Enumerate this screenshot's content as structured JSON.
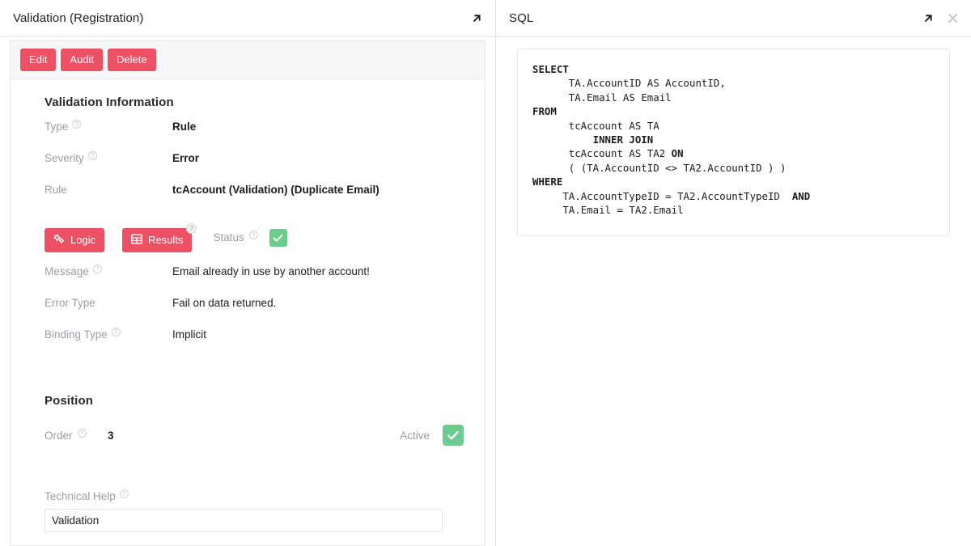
{
  "left_panel": {
    "title": "Validation (Registration)",
    "expand_icon": "expand-arrow-icon",
    "toolbar": {
      "edit_label": "Edit",
      "audit_label": "Audit",
      "delete_label": "Delete"
    },
    "sections": {
      "validation_information": {
        "heading": "Validation Information",
        "fields": [
          {
            "label": "Type",
            "value": "Rule",
            "has_help": true
          },
          {
            "label": "Severity",
            "value": "Error",
            "has_help": true
          },
          {
            "label": "Rule",
            "value": "tcAccount (Validation) (Duplicate Email)",
            "has_help": false
          }
        ]
      },
      "actions": {
        "logic_label": "Logic",
        "logic_icon": "cogs-icon",
        "results_label": "Results",
        "results_icon": "table-grid-icon",
        "status_label": "Status",
        "status_checked": true
      },
      "details": {
        "fields": [
          {
            "label": "Message",
            "value": "Email already in use by another account!",
            "has_help": true
          },
          {
            "label": "Error Type",
            "value": "Fail on data returned.",
            "has_help": false
          },
          {
            "label": "Binding Type",
            "value": "Implicit",
            "has_help": true
          }
        ]
      },
      "position": {
        "heading": "Position",
        "order_label": "Order",
        "order_value": "3",
        "active_label": "Active",
        "active_checked": true
      },
      "technical_help": {
        "label": "Technical Help",
        "value": "Validation",
        "placeholder": "Technical Help"
      }
    }
  },
  "right_panel": {
    "title": "SQL",
    "expand_icon": "expand-arrow-icon",
    "close_icon": "close-icon",
    "sql_lines": [
      {
        "keyword": "SELECT",
        "rest": ""
      },
      {
        "keyword": "",
        "rest": "      TA.AccountID AS AccountID,"
      },
      {
        "keyword": "",
        "rest": "      TA.Email AS Email"
      },
      {
        "keyword": "FROM",
        "rest": ""
      },
      {
        "keyword": "",
        "rest": "      tcAccount AS TA"
      },
      {
        "keyword": "INNER JOIN",
        "rest": "",
        "indent": 10
      },
      {
        "keyword": "",
        "rest": "      tcAccount AS TA2 ",
        "keyword_tail": "ON"
      },
      {
        "keyword": "",
        "rest": "      ( (TA.AccountID <> TA2.AccountID ) )"
      },
      {
        "keyword": "WHERE",
        "rest": ""
      },
      {
        "keyword": "",
        "rest": "     TA.AccountTypeID = TA2.AccountTypeID  ",
        "keyword_tail": "AND"
      },
      {
        "keyword": "",
        "rest": "     TA.Email = TA2.Email"
      }
    ],
    "sql_text": "SELECT\n      TA.AccountID AS AccountID,\n      TA.Email AS Email\nFROM\n      tcAccount AS TA\n          INNER JOIN\n      tcAccount AS TA2 ON\n      ( (TA.AccountID <> TA2.AccountID ) )\nWHERE\n     TA.AccountTypeID = TA2.AccountTypeID  AND\n     TA.Email = TA2.Email"
  },
  "colors": {
    "accent_red": "#ef5164",
    "check_green": "#6ccb8e",
    "label_gray": "#9b9fa3",
    "border": "#e6e8ea"
  },
  "help_glyph": "?"
}
